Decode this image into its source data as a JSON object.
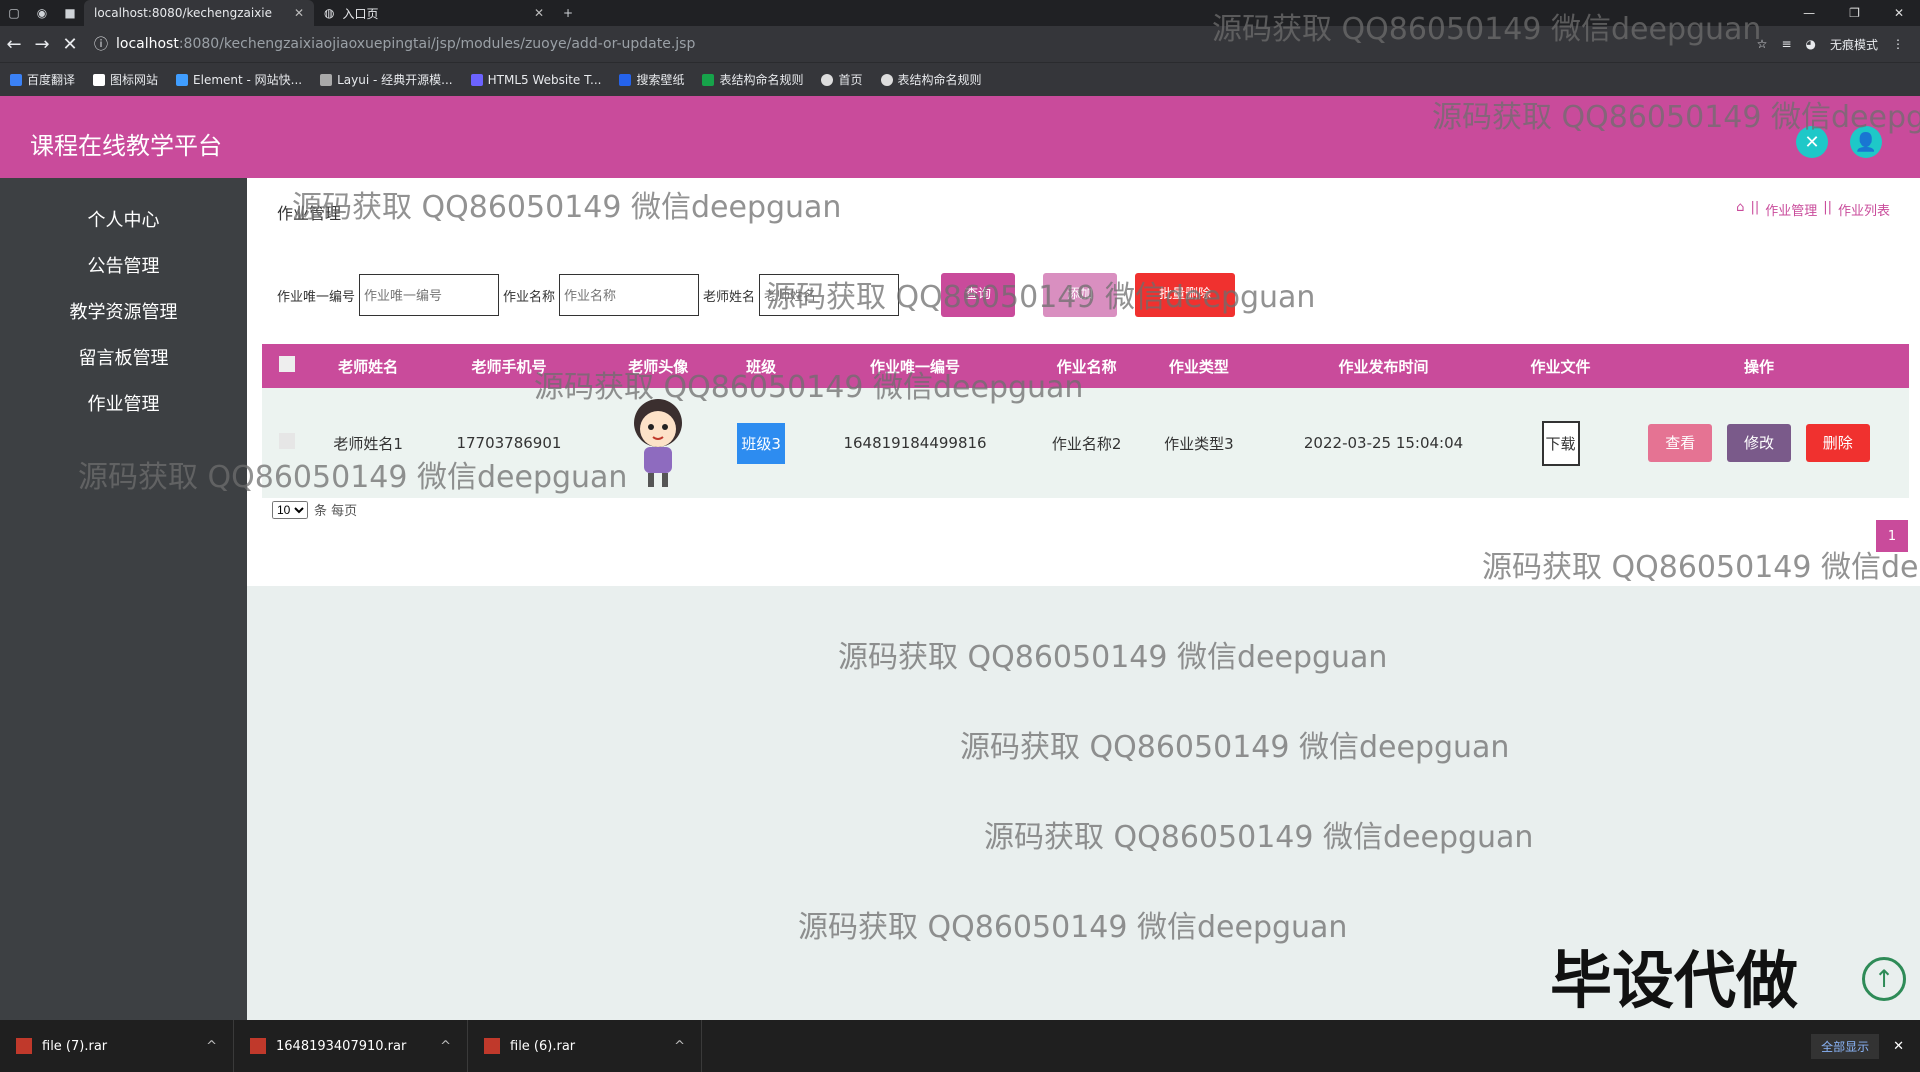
{
  "browser": {
    "tabs": [
      {
        "title": "localhost:8080/kechengzaixie",
        "active": true
      },
      {
        "title": "入口页",
        "active": false
      }
    ],
    "url_host": "localhost",
    "url_path": ":8080/kechengzaixiaojiaoxuepingtai/jsp/modules/zuoye/add-or-update.jsp",
    "profile_label": "无痕模式",
    "bookmarks": [
      "百度翻译",
      "图标网站",
      "Element - 网站快...",
      "Layui - 经典开源模...",
      "HTML5 Website T...",
      "搜索壁纸",
      "表结构命名规则",
      "首页",
      "表结构命名规则"
    ]
  },
  "header": {
    "title": "课程在线教学平台"
  },
  "sidebar": {
    "items": [
      "个人中心",
      "公告管理",
      "教学资源管理",
      "留言板管理",
      "作业管理"
    ]
  },
  "page": {
    "title": "作业管理",
    "breadcrumb": [
      "作业管理",
      "作业列表"
    ]
  },
  "search": {
    "label1": "作业唯一编号",
    "placeholder1": "作业唯一编号",
    "label2": "作业名称",
    "placeholder2": "作业名称",
    "label3": "老师姓名",
    "placeholder3": "老师姓名",
    "query_btn": "查询",
    "add_btn": "添加",
    "delete_btn": "批量删除"
  },
  "table": {
    "headers": [
      "老师姓名",
      "老师手机号",
      "老师头像",
      "班级",
      "作业唯一编号",
      "作业名称",
      "作业类型",
      "作业发布时间",
      "作业文件",
      "操作"
    ],
    "rows": [
      {
        "teacher": "老师姓名1",
        "phone": "17703786901",
        "class": "班级3",
        "code": "1648191844 99816",
        "code_full": "164819184499816",
        "name": "作业名称2",
        "type": "作业类型3",
        "time": "2022-03-25 15:04:04",
        "file": "下载"
      }
    ],
    "ops": {
      "view": "查看",
      "edit": "修改",
      "delete": "删除"
    }
  },
  "pager": {
    "page_size": "10",
    "per_page_label": "条 每页",
    "current_page": "1"
  },
  "overlay": {
    "watermark": "源码获取 QQ86050149 微信deepguan",
    "bigtext": "毕设代做"
  },
  "taskbar": {
    "downloads": [
      "file (7).rar",
      "1648193407910.rar",
      "file (6).rar"
    ],
    "show_all": "全部显示"
  },
  "colors": {
    "accent": "#c94b9b",
    "sidebar": "#3d4043",
    "view_btn": "#e57393",
    "edit_btn": "#7a5a8a",
    "delete_btn": "#f0312f"
  }
}
